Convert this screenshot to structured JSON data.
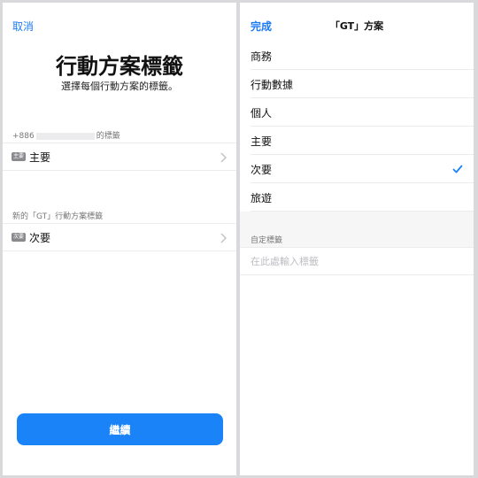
{
  "left": {
    "cancel_label": "取消",
    "title": "行動方案標籤",
    "subtitle": "選擇每個行動方案的標籤。",
    "primary_section": {
      "prefix": "+886",
      "suffix": "的標籤"
    },
    "primary_row": {
      "badge": "主要",
      "label": "主要"
    },
    "new_section_header": "新的「GT」行動方案標籤",
    "new_row": {
      "badge": "次要",
      "label": "次要"
    },
    "continue_label": "繼續"
  },
  "right": {
    "done_label": "完成",
    "nav_title": "「GT」方案",
    "items": [
      {
        "label": "商務",
        "selected": false
      },
      {
        "label": "行動數據",
        "selected": false
      },
      {
        "label": "個人",
        "selected": false
      },
      {
        "label": "主要",
        "selected": false
      },
      {
        "label": "次要",
        "selected": true
      },
      {
        "label": "旅遊",
        "selected": false
      }
    ],
    "custom_header": "自定標籤",
    "custom_placeholder": "在此處輸入標籤",
    "custom_value": ""
  },
  "colors": {
    "accent": "#1a83f8",
    "link": "#1d7cf2",
    "badge": "#8a8a8e",
    "separator": "#ececec"
  }
}
